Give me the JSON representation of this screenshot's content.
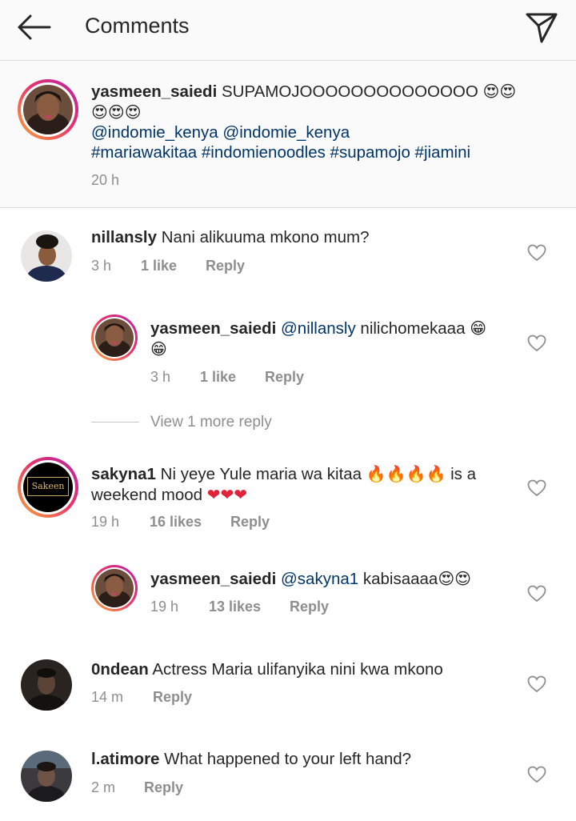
{
  "header": {
    "title": "Comments"
  },
  "caption": {
    "username": "yasmeen_saiedi",
    "text": "SUPAMOJOOOOOOOOOOOOOO",
    "emojis": "😍😍",
    "emojis_line2": "😍😍😍",
    "mentions": "@indomie_kenya @indomie_kenya",
    "hashtags": "#mariawakitaa #indomienoodles #supamojo #jiamini",
    "time": "20 h"
  },
  "comments": [
    {
      "username": "nillansly",
      "text": "Nani alikuuma mkono mum?",
      "time": "3 h",
      "likes": "1 like",
      "reply": "Reply"
    },
    {
      "username": "yasmeen_saiedi",
      "mention": "@nillansly",
      "text": "nilichomekaaa",
      "emoji1": "😁",
      "emoji2": "😁",
      "time": "3 h",
      "likes": "1 like",
      "reply": "Reply"
    },
    {
      "view_more": "View 1 more reply"
    },
    {
      "username": "sakyna1",
      "text": "Ni yeye Yule maria wa kitaa",
      "fire": "🔥🔥🔥🔥",
      "text2": "is a",
      "line2": "weekend mood",
      "hearts": "❤❤❤",
      "time": "19 h",
      "likes": "16 likes",
      "reply": "Reply",
      "avatar_label": "Sakeen"
    },
    {
      "username": "yasmeen_saiedi",
      "mention": "@sakyna1",
      "text": "kabisaaaa",
      "emojis": "😍😍",
      "time": "19 h",
      "likes": "13 likes",
      "reply": "Reply"
    },
    {
      "username": "0ndean",
      "text": "Actress Maria ulifanyika nini kwa mkono",
      "time": "14 m",
      "reply": "Reply"
    },
    {
      "username": "l.atimore",
      "text": "What happened to your left hand?",
      "time": "2 m",
      "reply": "Reply"
    }
  ]
}
